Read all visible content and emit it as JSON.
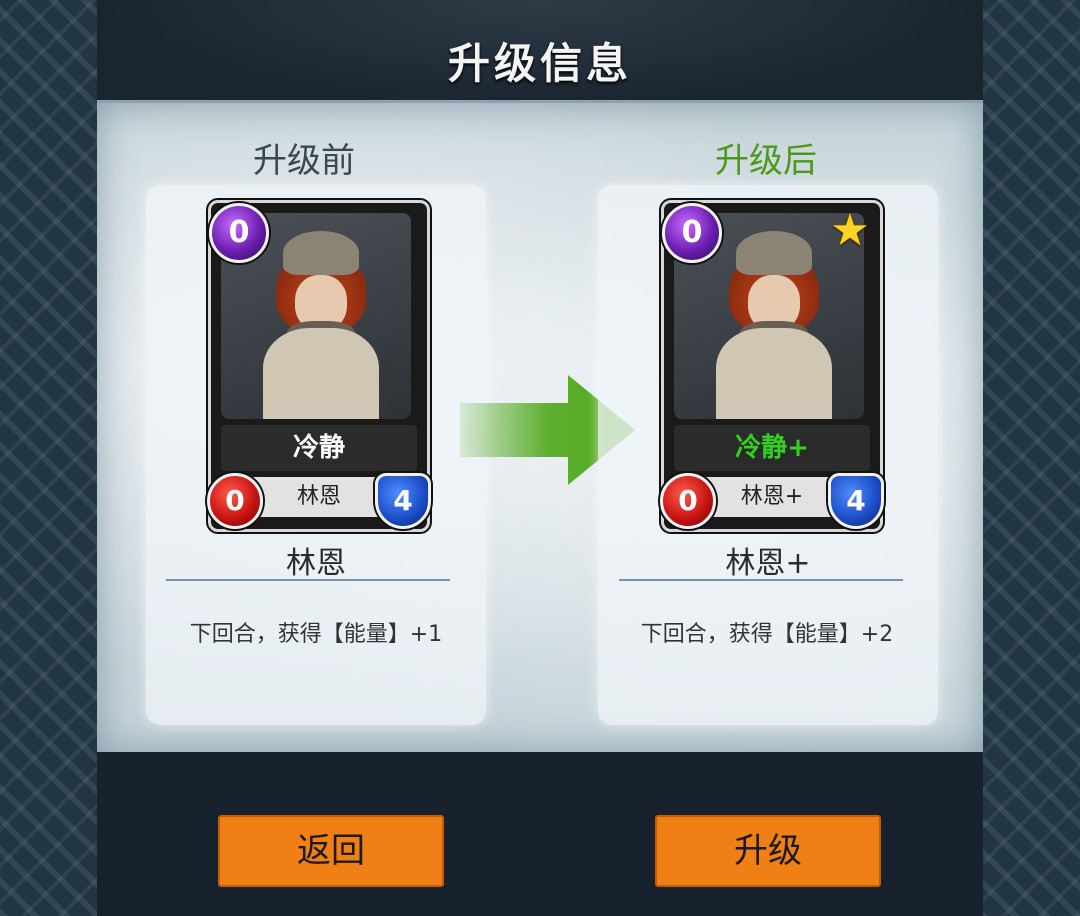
{
  "title": "升级信息",
  "before": {
    "label": "升级前",
    "card": {
      "cost": "0",
      "name": "冷静",
      "owner": "林恩",
      "attack": "0",
      "defense": "4"
    },
    "card_title": "林恩",
    "description": "下回合，获得【能量】+1"
  },
  "after": {
    "label": "升级后",
    "card": {
      "cost": "0",
      "name": "冷静+",
      "owner": "林恩+",
      "attack": "0",
      "defense": "4",
      "upgraded_star": "star-icon"
    },
    "card_title": "林恩+",
    "description": "下回合，获得【能量】+2"
  },
  "buttons": {
    "back_label": "返回",
    "upgrade_label": "升级"
  },
  "colors": {
    "after_label": "#4c9a1a",
    "upgraded_name": "#32d11e",
    "button": "#f08016",
    "arrow": "#4fa81a"
  }
}
